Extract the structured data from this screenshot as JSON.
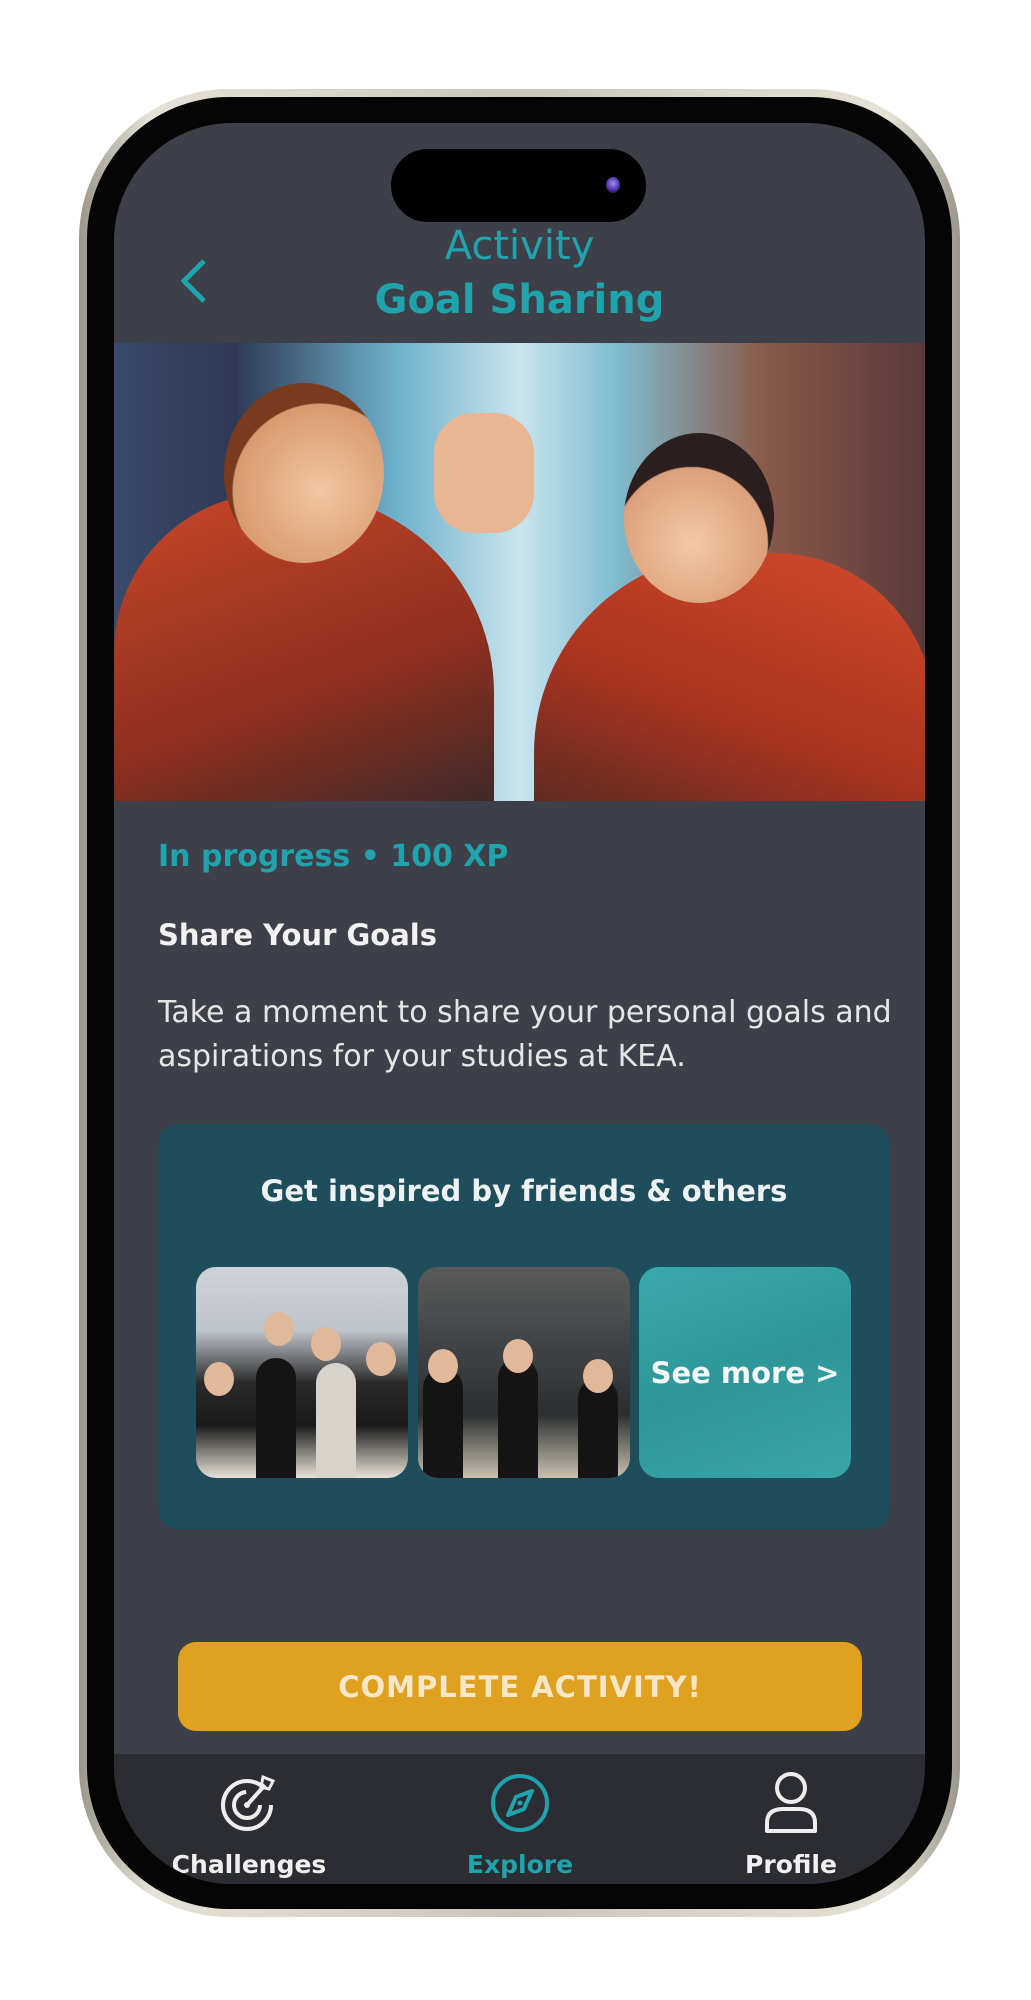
{
  "header": {
    "subtitle": "Activity",
    "title": "Goal Sharing",
    "back_icon": "chevron-left-icon"
  },
  "activity": {
    "status": "In progress • 100 XP",
    "heading": "Share Your Goals",
    "description": "Take a moment to share your personal goals and aspirations for your studies at KEA."
  },
  "inspiration": {
    "title": "Get inspired by friends & others",
    "see_more": "See more >"
  },
  "cta": {
    "label": "COMPLETE ACTIVITY!"
  },
  "tabs": [
    {
      "label": "Challenges",
      "icon": "target-icon",
      "active": false
    },
    {
      "label": "Explore",
      "icon": "compass-icon",
      "active": true
    },
    {
      "label": "Profile",
      "icon": "user-icon",
      "active": false
    }
  ],
  "colors": {
    "accent": "#1fa3ac",
    "background": "#3d4049",
    "card": "#1e4d5c",
    "button": "#e0a020",
    "tabbar": "#2b2d33"
  }
}
